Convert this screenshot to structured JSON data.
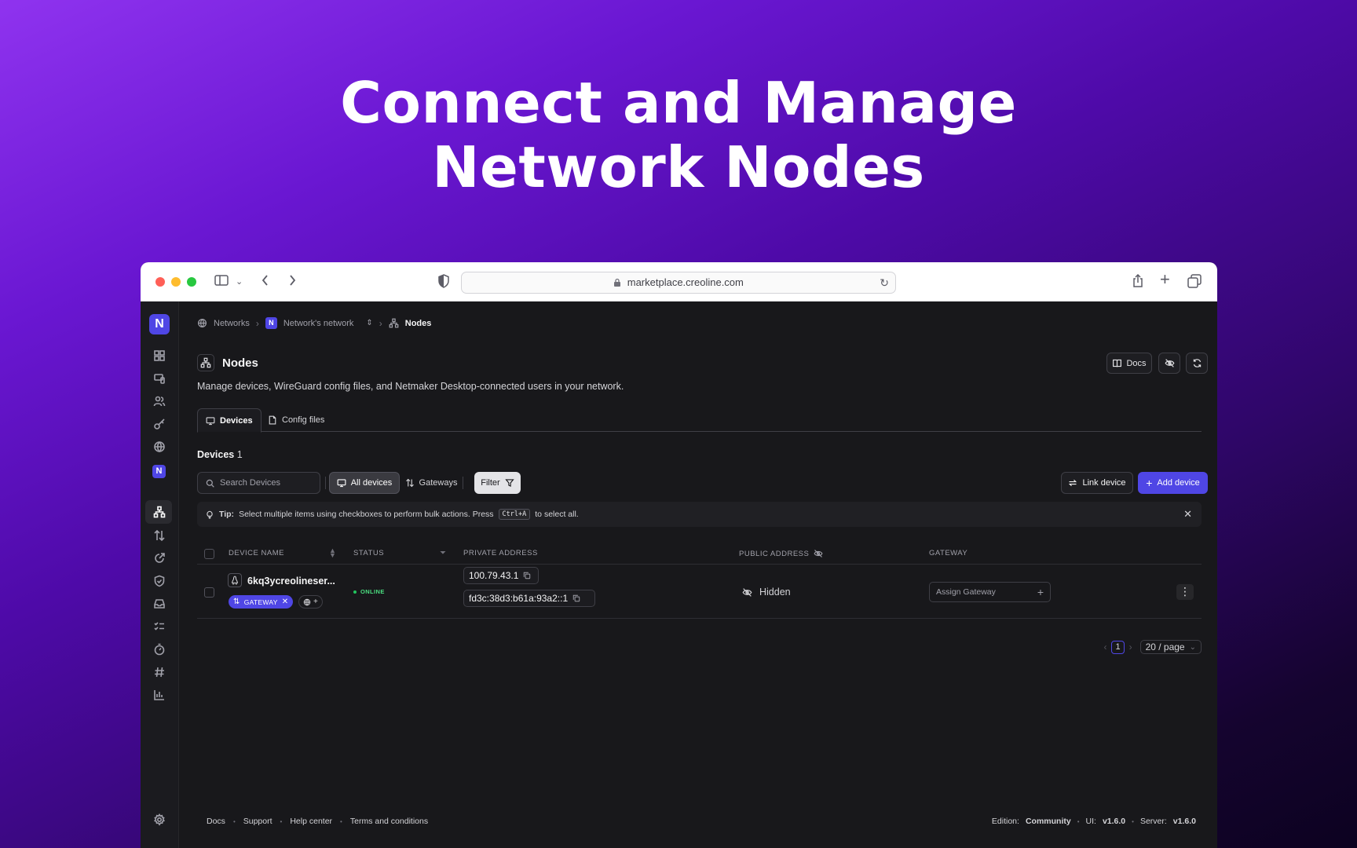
{
  "hero": {
    "line1": "Connect and Manage",
    "line2": "Network Nodes"
  },
  "browser": {
    "url": "marketplace.creoline.com"
  },
  "sidebar": {
    "logo": "N",
    "network_badge": "N"
  },
  "breadcrumb": {
    "networks": "Networks",
    "network_badge": "N",
    "network": "Network's network",
    "current": "Nodes"
  },
  "page": {
    "title": "Nodes",
    "description": "Manage devices, WireGuard config files, and Netmaker Desktop-connected users in your network.",
    "docs_label": "Docs"
  },
  "tabs": [
    {
      "label": "Devices"
    },
    {
      "label": "Config files"
    }
  ],
  "devices": {
    "label": "Devices",
    "count": "1"
  },
  "toolbar": {
    "search_placeholder": "Search Devices",
    "all_devices": "All devices",
    "gateways": "Gateways",
    "filter": "Filter",
    "link_device": "Link device",
    "add_device": "Add device"
  },
  "tip": {
    "prefix": "Tip:",
    "text": "Select multiple items using checkboxes to perform bulk actions. Press",
    "key": "Ctrl+A",
    "suffix": "to select all."
  },
  "table": {
    "headers": [
      "DEVICE NAME",
      "STATUS",
      "PRIVATE ADDRESS",
      "PUBLIC ADDRESS",
      "GATEWAY"
    ],
    "rows": [
      {
        "name": "6kq3ycreolineser...",
        "tag": "GATEWAY",
        "status": "ONLINE",
        "ipv4": "100.79.43.1",
        "ipv6": "fd3c:38d3:b61a:93a2::1",
        "public": "Hidden",
        "gateway_placeholder": "Assign Gateway"
      }
    ]
  },
  "pagination": {
    "page": "1",
    "per_page": "20 / page"
  },
  "footer": {
    "links": [
      "Docs",
      "Support",
      "Help center",
      "Terms and conditions"
    ],
    "edition_label": "Edition:",
    "edition": "Community",
    "ui_label": "UI:",
    "ui": "v1.6.0",
    "server_label": "Server:",
    "server": "v1.6.0"
  },
  "colors": {
    "accent": "#4f46e5",
    "online": "#22c55e"
  }
}
